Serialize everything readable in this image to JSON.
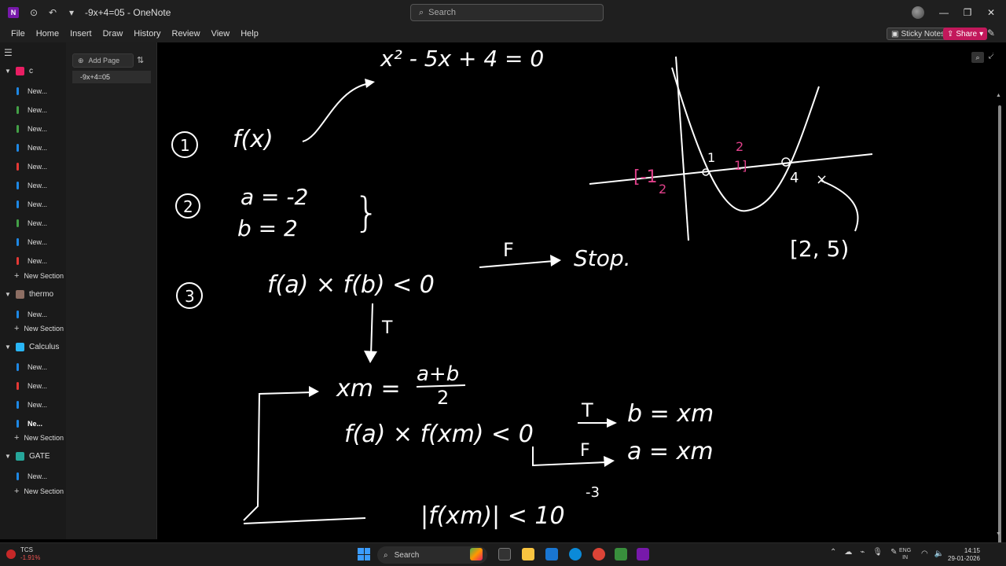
{
  "titlebar": {
    "window_title": "-9x+4=05 - OneNote",
    "search_placeholder": "Search",
    "app_logo_text": "N"
  },
  "menu": {
    "items": [
      "File",
      "Home",
      "Insert",
      "Draw",
      "History",
      "Review",
      "View",
      "Help"
    ],
    "sticky_notes": "Sticky Notes",
    "share": "Share"
  },
  "notebooks": {
    "nb1": {
      "name": "c",
      "color": "#e91e63"
    },
    "nb1_sections": [
      {
        "label": "New...",
        "color": "#1e88e5"
      },
      {
        "label": "New...",
        "color": "#43a047"
      },
      {
        "label": "New...",
        "color": "#43a047"
      },
      {
        "label": "New...",
        "color": "#1e88e5"
      },
      {
        "label": "New...",
        "color": "#e53935"
      },
      {
        "label": "New...",
        "color": "#1e88e5"
      },
      {
        "label": "New...",
        "color": "#1e88e5"
      },
      {
        "label": "New...",
        "color": "#43a047"
      },
      {
        "label": "New...",
        "color": "#1e88e5"
      },
      {
        "label": "New...",
        "color": "#e53935"
      }
    ],
    "new_section": "New Section",
    "nb2": {
      "name": "thermo",
      "color": "#8d6e63"
    },
    "nb2_sections": [
      {
        "label": "New...",
        "color": "#1e88e5"
      }
    ],
    "nb3": {
      "name": "Calculus",
      "color": "#29b6f6"
    },
    "nb3_sections": [
      {
        "label": "New...",
        "color": "#1e88e5"
      },
      {
        "label": "New...",
        "color": "#e53935"
      },
      {
        "label": "New...",
        "color": "#1e88e5"
      },
      {
        "label": "Ne...",
        "color": "#1e88e5"
      }
    ],
    "nb4": {
      "name": "GATE",
      "color": "#26a69a"
    },
    "nb4_sections": [
      {
        "label": "New...",
        "color": "#1e88e5"
      }
    ]
  },
  "pages": {
    "add_page": "Add Page",
    "current_page": "-9x+4=05"
  },
  "ink": {
    "equation_top": "x² - 5x + 4 = 0",
    "step1_num": "1",
    "fx": "f(x)",
    "step2_num": "2",
    "a_eq": "a = -2",
    "b_eq": "b = 2",
    "brace": "}",
    "step3_num": "3",
    "condition": "f(a) × f(b) < 0",
    "false_label": "F",
    "stop": "Stop.",
    "true_label": "T",
    "xm_eq": "xm =",
    "frac_num": "a+b",
    "frac_den": "2",
    "cond2": "f(a) × f(xm) < 0",
    "t2": "T",
    "b_assign": "b = xm",
    "f2": "F",
    "a_assign": "a = xm",
    "tolerance": "|f(xm)| < 10",
    "exponent": "-3",
    "root1": "1",
    "root2": "4",
    "pink_2": "2",
    "pink_1": "1]",
    "pink_bracket": "[-1",
    "pink_2b": "2",
    "interval": "[2, 5)"
  },
  "taskbar": {
    "stock_name": "TCS",
    "stock_change": "-1.91%",
    "search": "Search",
    "lang_line1": "ENG",
    "lang_line2": "IN",
    "time": "14:15",
    "date": "29-01-2026"
  }
}
